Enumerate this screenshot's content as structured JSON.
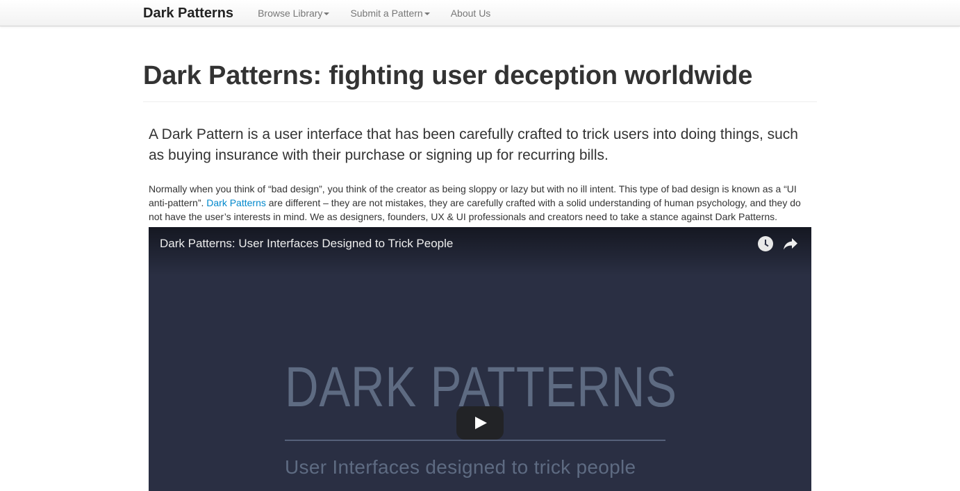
{
  "navbar": {
    "brand": "Dark Patterns",
    "items": [
      {
        "label": "Browse Library",
        "dropdown": true
      },
      {
        "label": "Submit a Pattern",
        "dropdown": true
      },
      {
        "label": "About Us",
        "dropdown": false
      }
    ]
  },
  "main": {
    "title": "Dark Patterns: fighting user deception worldwide",
    "lead": "A Dark Pattern is a user interface that has been carefully crafted to trick users into doing things, such as buying insurance with their purchase or signing up for recurring bills.",
    "body_before_link": "Normally when you think of “bad design”, you think of the creator as being sloppy or lazy but with no ill intent. This type of bad design is known as a “UI anti-pattern”. ",
    "body_link": "Dark Patterns",
    "body_after_link": " are different – they are not mistakes, they are carefully crafted with a solid understanding of human psychology, and they do not have the user’s interests in mind. We as designers, founders, UX & UI professionals and creators need to take a stance against Dark Patterns."
  },
  "video": {
    "title": "Dark Patterns: User Interfaces Designed to Trick People",
    "logo_text": "DARK PATTERNS",
    "subtitle": "User Interfaces designed to trick people",
    "icons": [
      "watch-later-icon",
      "share-icon",
      "play-icon"
    ]
  },
  "colors": {
    "link": "#0088cc",
    "video_bg": "#2a2f43",
    "navbar_text": "#777777"
  }
}
